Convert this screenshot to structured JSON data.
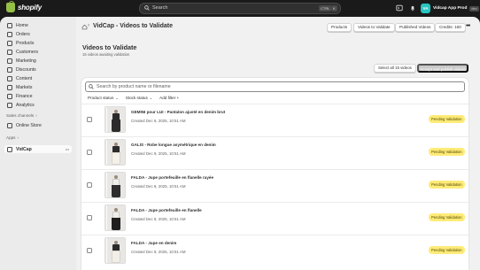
{
  "topbar": {
    "brand": "shopify",
    "search_placeholder": "Search",
    "shortcut_keys": [
      "CTRL",
      "K"
    ],
    "store_initials": "VA",
    "store_name": "Vidcap App Prod",
    "store_badge": "dev"
  },
  "sidebar": {
    "items": [
      {
        "label": "Home",
        "icon": "home-icon"
      },
      {
        "label": "Orders",
        "icon": "orders-icon"
      },
      {
        "label": "Products",
        "icon": "tag-icon"
      },
      {
        "label": "Customers",
        "icon": "person-icon"
      },
      {
        "label": "Marketing",
        "icon": "target-icon"
      },
      {
        "label": "Discounts",
        "icon": "discount-icon"
      },
      {
        "label": "Content",
        "icon": "content-icon"
      },
      {
        "label": "Markets",
        "icon": "globe-icon"
      },
      {
        "label": "Finance",
        "icon": "bank-icon"
      },
      {
        "label": "Analytics",
        "icon": "chart-icon"
      }
    ],
    "sales_channels_title": "Sales channels",
    "online_store": "Online Store",
    "apps_title": "Apps",
    "app_item": "VidCap"
  },
  "header": {
    "title": "VidCap - Videos to Validate",
    "buttons": [
      "Products",
      "Videos to Validate",
      "Published Videos",
      "Credits: 160"
    ]
  },
  "page": {
    "title": "Videos to Validate",
    "subtitle": "15 videos awaiting validation",
    "select_all": "Select all 15 videos",
    "accept_all": "Accept and publish videos",
    "search_placeholder": "Search by product name or filename",
    "filters": [
      "Product status",
      "Stock status",
      "Add filter +"
    ]
  },
  "rows": [
    {
      "title": "GEMINI pour LUI - Pantalon ajusté en denim brut",
      "date": "Created Dec 9, 2025, 10:51 AM",
      "status": "Pending Validation",
      "bottom_color": "#2b2b2b"
    },
    {
      "title": "GALIS - Robe longue asymétrique en denim",
      "date": "Created Dec 9, 2025, 10:51 AM",
      "status": "Pending Validation",
      "bottom_color": "#f4f1ea"
    },
    {
      "title": "FALDA - Jupe portefeuille en flanelle rayée",
      "date": "Created Dec 9, 2025, 10:51 AM",
      "status": "Pending Validation",
      "bottom_color": "#2e2e2e"
    },
    {
      "title": "FALDA - Jupe portefeuille en flanelle",
      "date": "Created Dec 9, 2025, 10:51 AM",
      "status": "Pending Validation",
      "bottom_color": "#1f1f1f"
    },
    {
      "title": "FALDA - Jupe en denim",
      "date": "Created Dec 9, 2025, 10:51 AM",
      "status": "Pending Validation",
      "bottom_color": "#f2efe8"
    }
  ]
}
